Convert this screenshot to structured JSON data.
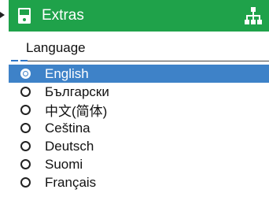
{
  "header": {
    "title": "Extras",
    "device_icon": "device-icon",
    "tree_icon": "network-tree-icon",
    "color": "#1fa24a"
  },
  "submenu": {
    "label": "Language"
  },
  "languages": [
    {
      "label": "English",
      "selected": true
    },
    {
      "label": "Български",
      "selected": false
    },
    {
      "label": "中文(简体)",
      "selected": false
    },
    {
      "label": "Ceština",
      "selected": false
    },
    {
      "label": "Deutsch",
      "selected": false
    },
    {
      "label": "Suomi",
      "selected": false
    },
    {
      "label": "Français",
      "selected": false
    }
  ],
  "colors": {
    "selected_bg": "#3e82c8",
    "accent_dash": "#2f76c6"
  }
}
